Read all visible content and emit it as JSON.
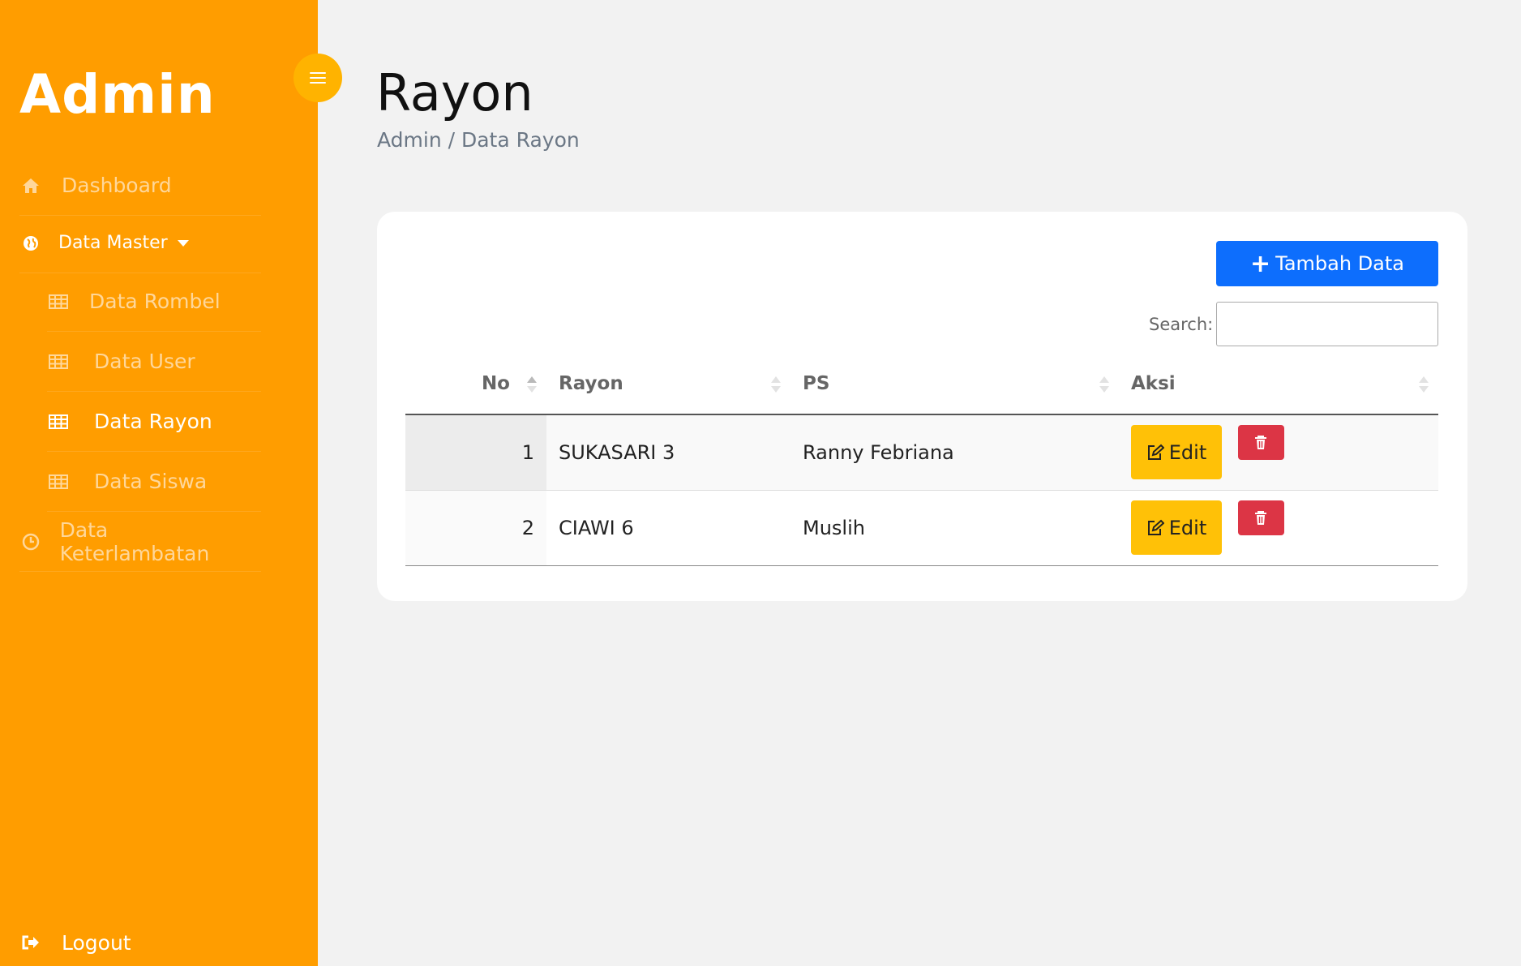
{
  "sidebar": {
    "brand": "Admin",
    "items": {
      "dashboard": "Dashboard",
      "data_master": "Data Master",
      "data_rombel": "Data Rombel",
      "data_user": "Data User",
      "data_rayon": "Data Rayon",
      "data_siswa": "Data Siswa",
      "data_keterlambatan": "Data Keterlambatan",
      "logout": "Logout"
    },
    "active_item": "Data Rayon",
    "colors": {
      "background": "#ff9d00",
      "toggle": "#ffb300"
    }
  },
  "header": {
    "title": "Rayon",
    "breadcrumb": "Admin / Data Rayon"
  },
  "toolbar": {
    "add_label": "Tambah Data",
    "search_label": "Search:",
    "search_value": ""
  },
  "table": {
    "columns": [
      "No",
      "Rayon",
      "PS",
      "Aksi"
    ],
    "sorted_column": "No",
    "rows": [
      {
        "no": "1",
        "rayon": "SUKASARI 3",
        "ps": "Ranny Febriana",
        "edit_label": "Edit"
      },
      {
        "no": "2",
        "rayon": "CIAWI 6",
        "ps": "Muslih",
        "edit_label": "Edit"
      }
    ]
  },
  "colors": {
    "primary": "#0d6efd",
    "warning": "#ffc107",
    "danger": "#dc3545"
  },
  "icons": [
    "menu-icon",
    "home-icon",
    "globe-icon",
    "table-icon",
    "clock-icon",
    "sign-out-icon",
    "plus-icon",
    "edit-icon",
    "trash-icon",
    "sort-icon"
  ]
}
